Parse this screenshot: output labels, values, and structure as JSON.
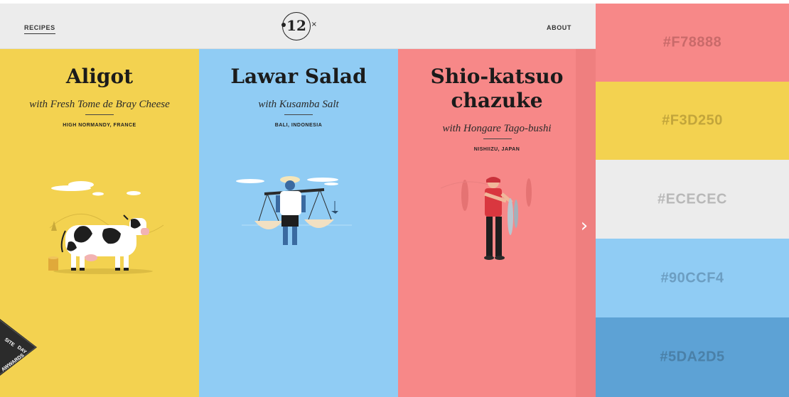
{
  "header": {
    "nav_left": "RECIPES",
    "nav_right": "ABOUT",
    "logo_text": "12",
    "logo_mark": "×"
  },
  "recipes": [
    {
      "title_line1": "Aligot",
      "title_line2": "",
      "subtitle": "with Fresh Tome de Bray Cheese",
      "location": "HIGH NORMANDY, FRANCE",
      "illustration": "cow-illustration"
    },
    {
      "title_line1": "Lawar Salad",
      "title_line2": "",
      "subtitle": "with Kusamba Salt",
      "location": "BALI, INDONESIA",
      "illustration": "salt-carrier-illustration"
    },
    {
      "title_line1": "Shio-katsuo",
      "title_line2": "chazuke",
      "subtitle": "with Hongare Tago-bushi",
      "location": "NISHIIZU, JAPAN",
      "illustration": "fisherman-illustration"
    }
  ],
  "controls": {
    "next_arrow": "›"
  },
  "badge": {
    "line1": "SITE",
    "line2": "DAY",
    "line3": "AWWARDS"
  },
  "palette": [
    {
      "hex": "#F78888",
      "label": "#F78888",
      "text_color": "#c96a6a"
    },
    {
      "hex": "#F3D250",
      "label": "#F3D250",
      "text_color": "#c2a53b"
    },
    {
      "hex": "#ECECEC",
      "label": "#ECECEC",
      "text_color": "#b8b8b8"
    },
    {
      "hex": "#90CCF4",
      "label": "#90CCF4",
      "text_color": "#6c9ec2"
    },
    {
      "hex": "#5DA2D5",
      "label": "#5DA2D5",
      "text_color": "#4a80a8"
    }
  ]
}
